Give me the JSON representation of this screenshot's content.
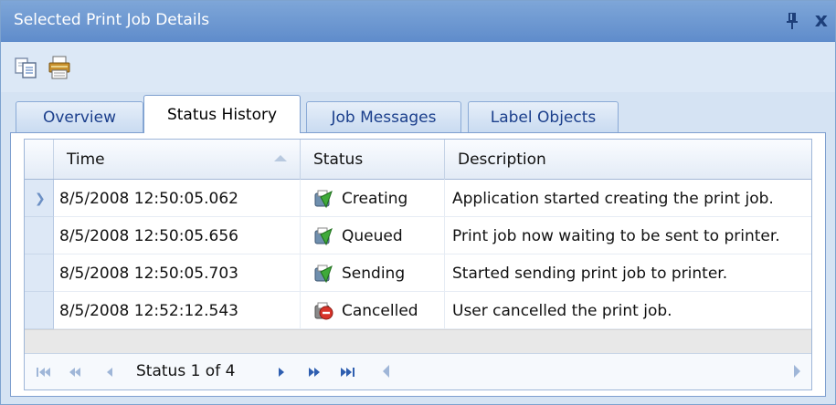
{
  "window": {
    "title": "Selected Print Job Details",
    "pin_icon": "pin-icon",
    "close_label": "x"
  },
  "toolbar": {
    "buttons": [
      {
        "icon": "copy-icon"
      },
      {
        "icon": "print-icon"
      }
    ]
  },
  "tabs": [
    {
      "label": "Overview",
      "active": false
    },
    {
      "label": "Status History",
      "active": true
    },
    {
      "label": "Job Messages",
      "active": false
    },
    {
      "label": "Label Objects",
      "active": false
    }
  ],
  "grid": {
    "columns": [
      "Time",
      "Status",
      "Description"
    ],
    "sorted_column": "Time",
    "sort_direction": "ascending",
    "rows": [
      {
        "time": "8/5/2008 12:50:05.062",
        "status": "Creating",
        "status_icon": "job-progress-icon",
        "description": "Application started creating the print job.",
        "selected": true
      },
      {
        "time": "8/5/2008 12:50:05.656",
        "status": "Queued",
        "status_icon": "job-progress-icon",
        "description": "Print job now waiting to be sent to printer.",
        "selected": false
      },
      {
        "time": "8/5/2008 12:50:05.703",
        "status": "Sending",
        "status_icon": "job-progress-icon",
        "description": "Started sending print job to printer.",
        "selected": false
      },
      {
        "time": "8/5/2008 12:52:12.543",
        "status": "Cancelled",
        "status_icon": "job-cancelled-icon",
        "description": "User cancelled the print job.",
        "selected": false
      }
    ]
  },
  "navigator": {
    "label": "Status 1 of 4",
    "current": 1,
    "total": 4
  },
  "colors": {
    "title_bar": "#6f9ad2",
    "accent": "#1b3f8c",
    "panel": "#d5e3f3"
  }
}
